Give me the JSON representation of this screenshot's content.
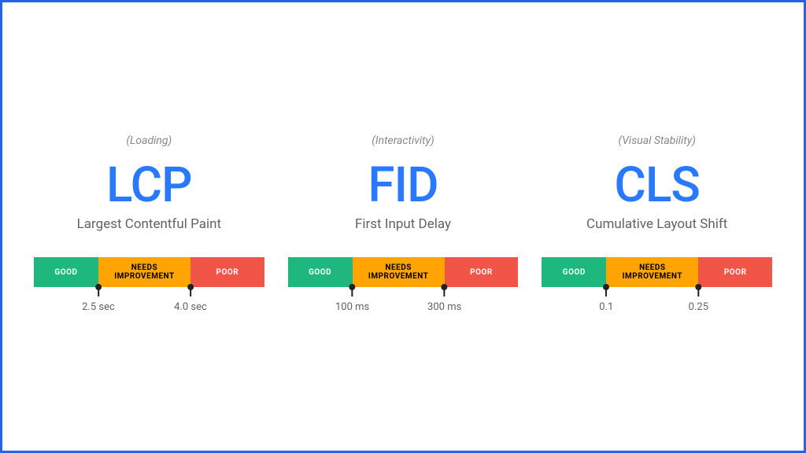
{
  "metrics": [
    {
      "category": "(Loading)",
      "abbr": "LCP",
      "fullname": "Largest Contentful Paint",
      "segments": {
        "good": "GOOD",
        "needs": "NEEDS IMPROVEMENT",
        "poor": "POOR"
      },
      "thresholds": {
        "low": "2.5 sec",
        "high": "4.0 sec"
      }
    },
    {
      "category": "(Interactivity)",
      "abbr": "FID",
      "fullname": "First Input Delay",
      "segments": {
        "good": "GOOD",
        "needs": "NEEDS IMPROVEMENT",
        "poor": "POOR"
      },
      "thresholds": {
        "low": "100 ms",
        "high": "300 ms"
      }
    },
    {
      "category": "(Visual Stability)",
      "abbr": "CLS",
      "fullname": "Cumulative Layout Shift",
      "segments": {
        "good": "GOOD",
        "needs": "NEEDS IMPROVEMENT",
        "poor": "POOR"
      },
      "thresholds": {
        "low": "0.1",
        "high": "0.25"
      }
    }
  ],
  "colors": {
    "good": "#1eb77e",
    "needs": "#ffa400",
    "poor": "#f05548",
    "accent": "#2979ff",
    "border": "#2563eb"
  }
}
